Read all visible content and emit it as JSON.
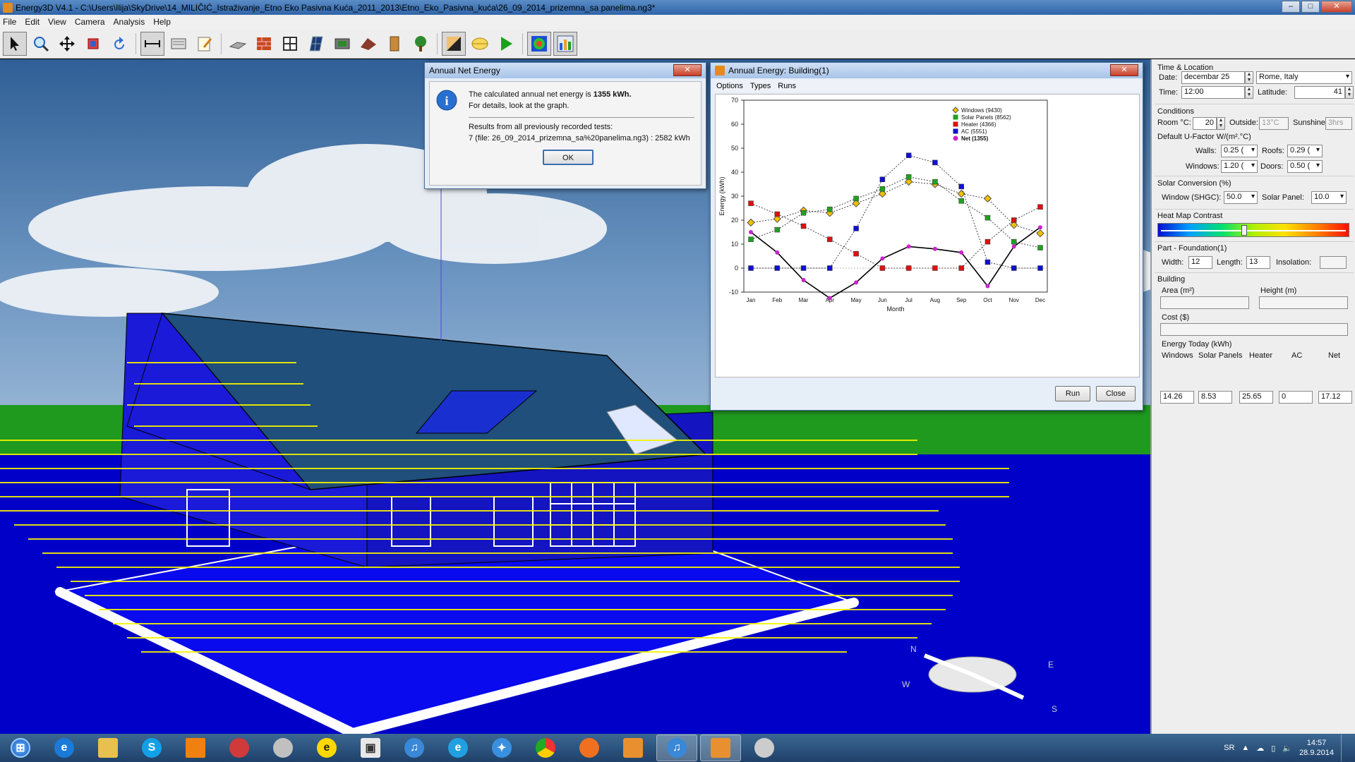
{
  "window": {
    "title": "Energy3D V4.1 - C:\\Users\\Ilija\\SkyDrive\\14_MILIČIĆ_Istraživanje_Etno Eko Pasivna Kuća_2011_2013\\Etno_Eko_Pasivna_kuća\\26_09_2014_prizemna_sa panelima.ng3*",
    "controls": {
      "minimize": "–",
      "maximize": "□",
      "close": "✕"
    }
  },
  "menu": [
    "File",
    "Edit",
    "View",
    "Camera",
    "Analysis",
    "Help"
  ],
  "toolbar": {
    "icons": [
      "select-arrow-icon",
      "zoom-icon",
      "move-icon",
      "resize-icon",
      "rotate-icon",
      "measure-icon",
      "note-icon",
      "notepad-icon",
      "platform-icon",
      "wall-icon",
      "window-icon",
      "solar-panel-icon",
      "sensor-icon",
      "roof-icon",
      "door-icon",
      "tree-icon",
      "shadow-icon",
      "heliodon-icon",
      "run-icon",
      "heatmap-icon",
      "energy-graph-icon"
    ]
  },
  "net_energy_dialog": {
    "title": "Annual Net Energy",
    "line1_prefix": "The calculated annual net energy is ",
    "line1_value": "1355 kWh.",
    "line2": "For details, look at the graph.",
    "line3": "Results from all previously recorded tests:",
    "line4": "7 (file: 26_09_2014_prizemna_sa%20panelima.ng3) : 2582 kWh",
    "ok": "OK"
  },
  "energy_dialog": {
    "title": "Annual Energy: Building(1)",
    "menu": [
      "Options",
      "Types",
      "Runs"
    ],
    "run": "Run",
    "close": "Close"
  },
  "chart_data": {
    "type": "line",
    "xlabel": "Month",
    "ylabel": "Energy (kWh)",
    "ylim": [
      -10,
      70
    ],
    "yticks": [
      -10,
      0,
      10,
      20,
      30,
      40,
      50,
      60,
      70
    ],
    "categories": [
      "Jan",
      "Feb",
      "Mar",
      "Apr",
      "May",
      "Jun",
      "Jul",
      "Aug",
      "Sep",
      "Oct",
      "Nov",
      "Dec"
    ],
    "series": [
      {
        "name": "Windows (9430)",
        "color": "#f0c000",
        "values": [
          19,
          20.5,
          24,
          23,
          27,
          31,
          36,
          35,
          31,
          29,
          18,
          14.5
        ]
      },
      {
        "name": "Solar Panels (8562)",
        "color": "#22a022",
        "values": [
          12,
          16,
          23,
          24.5,
          29,
          33,
          38,
          36,
          28,
          21,
          11,
          8.5
        ]
      },
      {
        "name": "Heater (4366)",
        "color": "#dd1111",
        "values": [
          27,
          22.5,
          17.5,
          12,
          6,
          0,
          0,
          0,
          0,
          11,
          20,
          25.5
        ]
      },
      {
        "name": "AC (5551)",
        "color": "#1010d0",
        "values": [
          0,
          0,
          0,
          0,
          16.5,
          37,
          47,
          44,
          34,
          2.5,
          0,
          0
        ]
      },
      {
        "name": "Net (1355)",
        "color": "#cc22cc",
        "values": [
          15,
          6.5,
          -5,
          -12.5,
          -6,
          4,
          9,
          8,
          6.5,
          -7.5,
          9,
          17
        ]
      }
    ]
  },
  "panel": {
    "time_location": "Time & Location",
    "date_label": "Date:",
    "date_value": "decembar 25",
    "location_value": "Rome, Italy",
    "time_label": "Time:",
    "time_value": "12:00",
    "latitude_label": "Latitude:",
    "latitude_value": "41",
    "conditions": "Conditions",
    "room_label": "Room °C:",
    "room_value": "20",
    "outside_label": "Outside:",
    "outside_value": "13°C",
    "sunshine_label": "Sunshine:",
    "sunshine_value": "3hrs",
    "ufactor": "Default U-Factor W/(m².°C)",
    "walls_label": "Walls:",
    "walls_value": "0.25 (",
    "roofs_label": "Roofs:",
    "roofs_value": "0.29 (",
    "windows_label": "Windows:",
    "windows_value": "1.20 (",
    "doors_label": "Doors:",
    "doors_value": "0.50 (",
    "solar_conversion": "Solar Conversion (%)",
    "shgc_label": "Window (SHGC):",
    "shgc_value": "50.0",
    "solarpanel_label": "Solar Panel:",
    "solarpanel_value": "10.0",
    "heatmap": "Heat Map Contrast",
    "heatmap_level": 0.45,
    "part": "Part - Foundation(1)",
    "width_label": "Width:",
    "width_value": "12",
    "length_label": "Length:",
    "length_value": "13",
    "insolation_label": "Insolation:",
    "insolation_value": "",
    "building": "Building",
    "area_label": "Area (m²)",
    "height_label": "Height (m)",
    "cost_label": "Cost ($)",
    "energy_today": "Energy Today (kWh)",
    "et_headers": [
      "Windows",
      "Solar Panels",
      "Heater",
      "AC",
      "Net"
    ],
    "et_values": [
      "14.26",
      "8.53",
      "25.65",
      "0",
      "17.12"
    ]
  },
  "compass": {
    "n": "N",
    "e": "E",
    "s": "S",
    "w": "W"
  },
  "taskbar": {
    "apps": [
      "start-orb-icon",
      "ie-icon",
      "explorer-icon",
      "skype-icon",
      "vlc-icon",
      "paint-icon",
      "tool-icon",
      "e-icon",
      "qr-icon",
      "itunes-icon",
      "ie-alt-icon",
      "safari-icon",
      "chrome-icon",
      "firefox-icon",
      "energy3d-icon",
      "itunes-alt-icon",
      "energy3d-active-icon",
      "paint2-icon"
    ],
    "language": "SR",
    "time": "14:57",
    "date": "28.9.2014"
  }
}
